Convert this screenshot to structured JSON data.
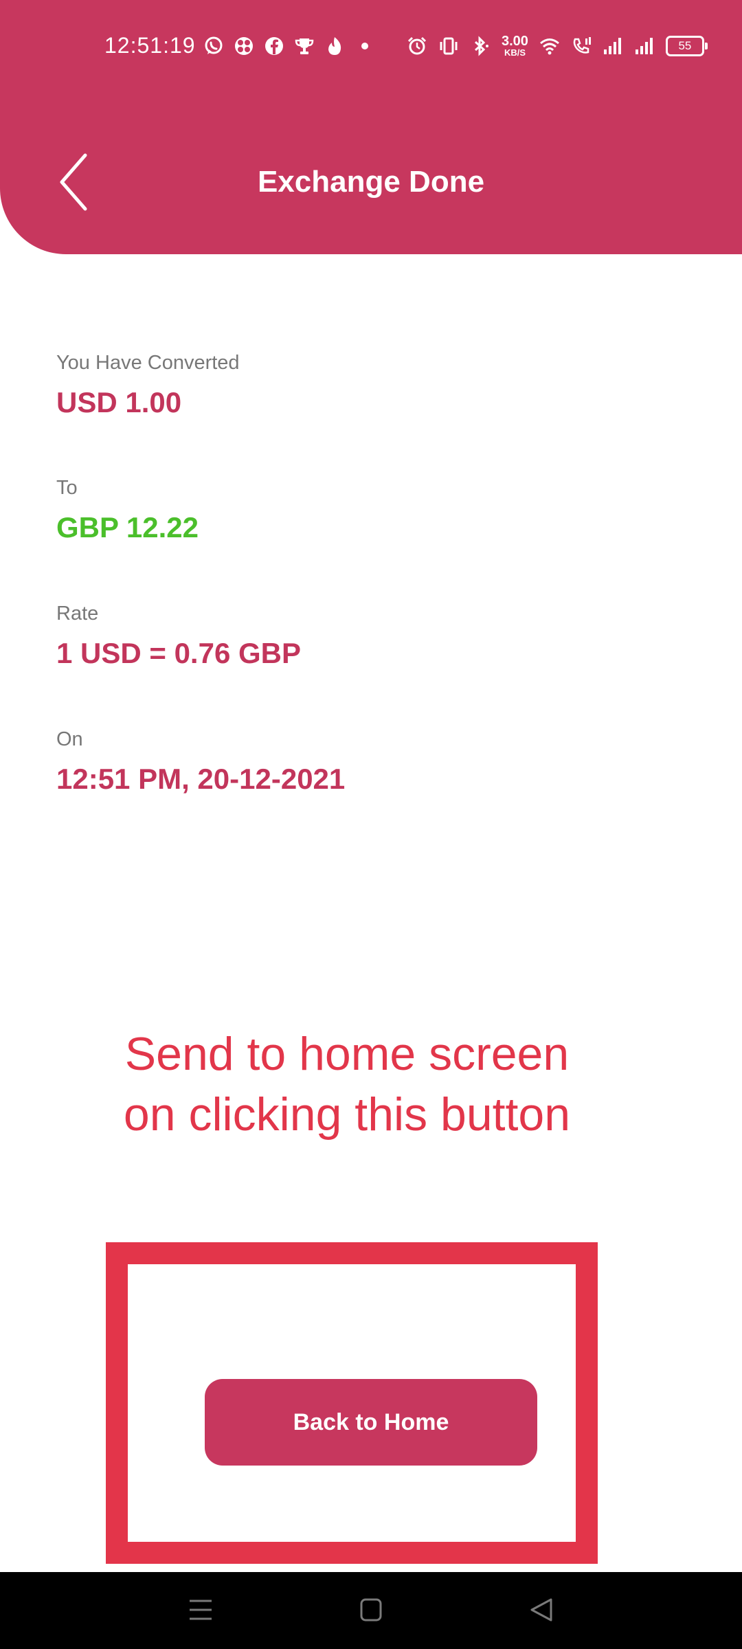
{
  "status_bar": {
    "time": "12:51:19",
    "network_speed_value": "3.00",
    "network_speed_unit": "KB/S",
    "battery": "55",
    "icons": [
      "whatsapp-icon",
      "pinwheel-icon",
      "facebook-icon",
      "trophy-icon",
      "flame-icon",
      "dot-icon",
      "alarm-icon",
      "vibrate-icon",
      "bluetooth-icon",
      "wifi-icon",
      "wifi-calling-icon",
      "signal-icon",
      "signal-icon"
    ]
  },
  "header": {
    "title": "Exchange Done",
    "background_color": "#c7375e"
  },
  "details": {
    "converted_label": "You Have Converted",
    "converted_value": "USD 1.00",
    "to_label": "To",
    "to_value": "GBP 12.22",
    "rate_label": "Rate",
    "rate_value": "1 USD = 0.76 GBP",
    "on_label": "On",
    "on_value": "12:51 PM, 20-12-2021"
  },
  "annotation": {
    "line1": "Send to home screen",
    "line2": "on clicking this button",
    "color": "#e3354a"
  },
  "actions": {
    "back_home_label": "Back to Home"
  },
  "colors": {
    "accent": "#c7375e",
    "positive": "#4bbf2b",
    "label_gray": "#777777"
  }
}
